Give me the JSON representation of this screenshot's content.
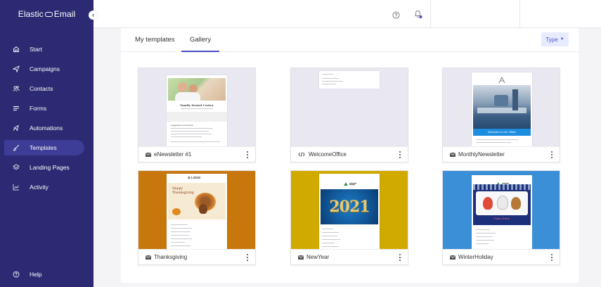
{
  "sidebar": {
    "logo_left": "Elastic",
    "logo_right": "Email",
    "items": [
      {
        "label": "Start",
        "icon": "home-icon"
      },
      {
        "label": "Campaigns",
        "icon": "send-icon"
      },
      {
        "label": "Contacts",
        "icon": "contacts-icon"
      },
      {
        "label": "Forms",
        "icon": "forms-icon"
      },
      {
        "label": "Automations",
        "icon": "automation-icon"
      },
      {
        "label": "Templates",
        "icon": "brush-icon"
      },
      {
        "label": "Landing Pages",
        "icon": "layers-icon"
      },
      {
        "label": "Activity",
        "icon": "chart-icon"
      }
    ],
    "help_label": "Help",
    "active_item": "Templates"
  },
  "tabs": {
    "my_templates": "My templates",
    "gallery": "Gallery",
    "active": "Gallery"
  },
  "type_button": "Type",
  "templates": [
    {
      "name": "eNewsletter #1",
      "icon": "envelope-icon",
      "preview_title": "Family Dental Center",
      "preview_heading": "Suggestions and Advice"
    },
    {
      "name": "WelcomeOffice",
      "icon": "code-icon"
    },
    {
      "name": "MonthlyNewsletter",
      "icon": "envelope-icon",
      "preview_banner": "Welcome to Our Office"
    },
    {
      "name": "Thanksgiving",
      "icon": "envelope-icon",
      "preview_logo": "LOGO",
      "preview_greeting": "Happy Thanksgiving"
    },
    {
      "name": "NewYear",
      "icon": "envelope-icon",
      "preview_year": "2021"
    },
    {
      "name": "WinterHoliday",
      "icon": "envelope-icon",
      "preview_caption": "Party Online"
    }
  ],
  "colors": {
    "sidebar_bg": "#2b2a72",
    "accent": "#4b4bc4",
    "thanksgiving_bg": "#c8770d",
    "newyear_bg": "#d1aa00",
    "winter_bg": "#3a8fd6"
  }
}
